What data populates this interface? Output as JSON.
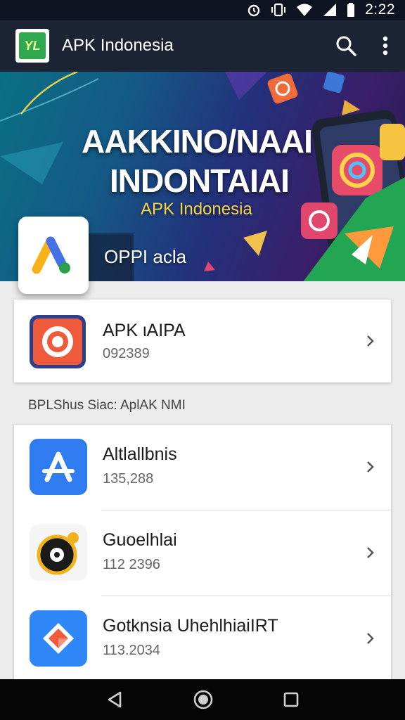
{
  "status_bar": {
    "time": "2:22"
  },
  "toolbar": {
    "title": "APK Indonesia",
    "logo_text": "YL"
  },
  "hero": {
    "title_line1": "AAKKINO/NAAI",
    "title_line2": "INDONTAIAI",
    "subtitle": "APK Indonesia",
    "caption": "OPPI acla"
  },
  "featured": {
    "title": "APK ιAIPA",
    "subtitle": "092389"
  },
  "section": {
    "header": "BPLShus Siac: AplAK NMI"
  },
  "list": [
    {
      "title": "Altlallbnis",
      "subtitle": "135,288",
      "icon": "app-store-icon"
    },
    {
      "title": "Guoelhlai",
      "subtitle": "112 2396",
      "icon": "disc-icon"
    },
    {
      "title": "Gotknsia UhehlhiaiIRT",
      "subtitle": "113.2034",
      "icon": "diamond-icon"
    }
  ],
  "colors": {
    "toolbar": "#1c2433",
    "status": "#0d1321",
    "accent_yellow": "#f4d64a",
    "list_blue": "#2f7cf0"
  }
}
